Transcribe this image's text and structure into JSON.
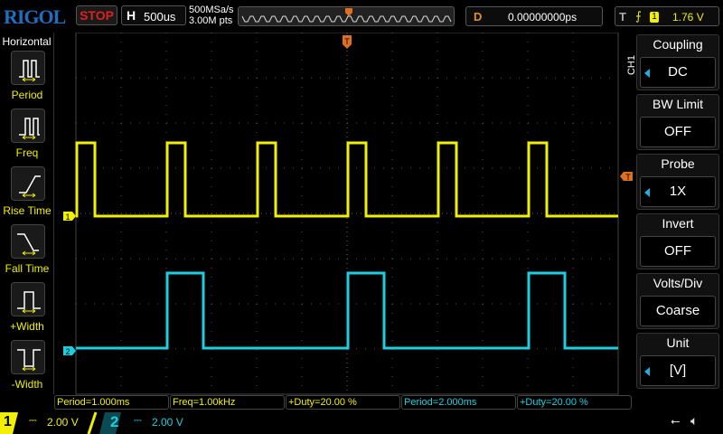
{
  "header": {
    "logo": "RIGOL",
    "run_state": "STOP",
    "h_label": "H",
    "timebase": "500us",
    "sample_rate": "500MSa/s",
    "memory_depth": "3.00M pts",
    "delay_label": "D",
    "delay": "0.00000000ps",
    "trigger_label": "T",
    "trigger_source": "1",
    "trigger_level": "1.76 V"
  },
  "left_menu": {
    "title": "Horizontal",
    "items": [
      {
        "label": "Period",
        "icon": "period-icon"
      },
      {
        "label": "Freq",
        "icon": "freq-icon"
      },
      {
        "label": "Rise Time",
        "icon": "rise-time-icon"
      },
      {
        "label": "Fall Time",
        "icon": "fall-time-icon"
      },
      {
        "label": "+Width",
        "icon": "pos-width-icon"
      },
      {
        "label": "-Width",
        "icon": "neg-width-icon"
      }
    ]
  },
  "right_menu": {
    "channel": "CH1",
    "items": [
      {
        "label": "Coupling",
        "value": "DC"
      },
      {
        "label": "BW Limit",
        "value": "OFF"
      },
      {
        "label": "Probe",
        "value": "1X"
      },
      {
        "label": "Invert",
        "value": "OFF"
      },
      {
        "label": "Volts/Div",
        "value": "Coarse"
      },
      {
        "label": "Unit",
        "value": "[V]"
      }
    ]
  },
  "measurements": [
    {
      "text": "Period=1.000ms",
      "channel": 1
    },
    {
      "text": "Freq=1.00kHz",
      "channel": 1
    },
    {
      "text": "+Duty=20.00 %",
      "channel": 1
    },
    {
      "text": "Period=2.000ms",
      "channel": 2
    },
    {
      "text": "+Duty=20.00 %",
      "channel": 2
    }
  ],
  "channels": [
    {
      "id": "1",
      "scale": "2.00 V",
      "color": "#f0f000"
    },
    {
      "id": "2",
      "scale": "2.00 V",
      "color": "#1ad0e0"
    }
  ],
  "waveforms": {
    "ch1": {
      "period_ms": 1.0,
      "duty": 0.2
    },
    "ch2": {
      "period_ms": 2.0,
      "duty": 0.2
    }
  },
  "markers": {
    "trigger": "T",
    "ch1": "1",
    "ch2": "2"
  }
}
